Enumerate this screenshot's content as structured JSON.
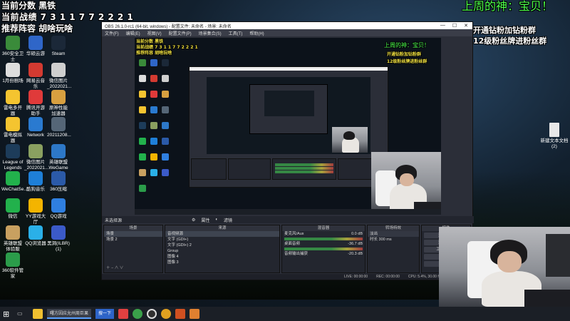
{
  "overlay": {
    "left_lines": [
      "当前分数 黑铁",
      "当前战绩 7 3 1 1 7 7 2 2 2 1",
      "推荐阵容 胡啥玩啥"
    ],
    "right_title": "上周的神：宝贝！",
    "right_lines": [
      "开通钻粉加钻粉群",
      "12级粉丝牌进粉丝群"
    ]
  },
  "desktop_icons": [
    {
      "label": "360安全卫士",
      "color": "#3a8b3a"
    },
    {
      "label": "华硕云游",
      "color": "#2f66c8"
    },
    {
      "label": "Steam",
      "color": "#1b2838"
    },
    {
      "label": "1月份剧场",
      "color": "#dddddd"
    },
    {
      "label": "网易云音乐",
      "color": "#d33a31"
    },
    {
      "label": "微信图片_2022021...",
      "color": "#cfcfcf"
    },
    {
      "label": "雷电多开器",
      "color": "#f4c430"
    },
    {
      "label": "腾讯开游助手",
      "color": "#e03a3a"
    },
    {
      "label": "原神性能加速器",
      "color": "#d8a040"
    },
    {
      "label": "雷电模拟器",
      "color": "#f4c430"
    },
    {
      "label": "Network",
      "color": "#2a7ad0"
    },
    {
      "label": "20211208...",
      "color": "#556677"
    },
    {
      "label": "League of Legends",
      "color": "#1d3c5a"
    },
    {
      "label": "微信图片_2022021...",
      "color": "#8aa060"
    },
    {
      "label": "英雄联盟WeGame版",
      "color": "#2d78c8"
    },
    {
      "label": "WeChatSe...",
      "color": "#22b14c"
    },
    {
      "label": "酷狗音乐",
      "color": "#1e7fd8"
    },
    {
      "label": "360压缩",
      "color": "#2b5aa8"
    },
    {
      "label": "微信",
      "color": "#22b14c"
    },
    {
      "label": "YY游戏大厅",
      "color": "#f4b400"
    },
    {
      "label": "QQ游戏",
      "color": "#2f7fe0"
    },
    {
      "label": "英雄联盟体验服",
      "color": "#c8a060"
    },
    {
      "label": "QQ浏览器",
      "color": "#2ab0e8"
    },
    {
      "label": "黑洞(ILBR)(1)",
      "color": "#3b5ac8"
    },
    {
      "label": "360软件管家",
      "color": "#2b9c4a"
    }
  ],
  "right_desktop_icons": [
    {
      "label": "新建文本文档(2)",
      "color": "#e8e8e8"
    }
  ],
  "obs": {
    "title": "OBS 26.1.0-rc1 (64-bit, windows) - 配置文件: 未命名 - 场景: 未命名",
    "window_controls": [
      "—",
      "☐",
      "✕"
    ],
    "menu": [
      "文件(F)",
      "编辑(E)",
      "视图(V)",
      "配置文件(P)",
      "场景集合(S)",
      "工具(T)",
      "帮助(H)"
    ],
    "scene_bar": {
      "label": "未选择源",
      "properties": "属性",
      "filters": "滤镜"
    },
    "docks": {
      "scenes": {
        "header": "场景",
        "items": [
          "场景",
          "场景 2"
        ]
      },
      "sources": {
        "header": "来源",
        "items": [
          "音视频源",
          "文字 (GDI+)",
          "文字 (GDI+) 2",
          "Group",
          "图像 4",
          "图像 3"
        ]
      },
      "mixer": {
        "header": "混音器",
        "tracks": [
          {
            "name": "麦克风/Aux",
            "level": "0.0 dB"
          },
          {
            "name": "桌面音频",
            "level": "-36.7 dB"
          },
          {
            "name": "音频输出捕获",
            "level": "-20.3 dB"
          }
        ]
      },
      "transitions": {
        "header": "转场特效",
        "type": "淡出",
        "duration_label": "时长",
        "duration": "300 ms"
      },
      "controls": {
        "header": "控件",
        "buttons": [
          "开始推流",
          "开始录制",
          "工作室模式",
          "设置",
          "退出"
        ]
      }
    },
    "status": {
      "live": "LIVE: 00:00:00",
      "rec": "REC: 00:00:00",
      "cpu": "CPU: 5.4%, 30.00 fps"
    }
  },
  "taskbar": {
    "start": "⊞",
    "search_app": "曙方因应允州周巨果",
    "active_app": "搜一下"
  }
}
